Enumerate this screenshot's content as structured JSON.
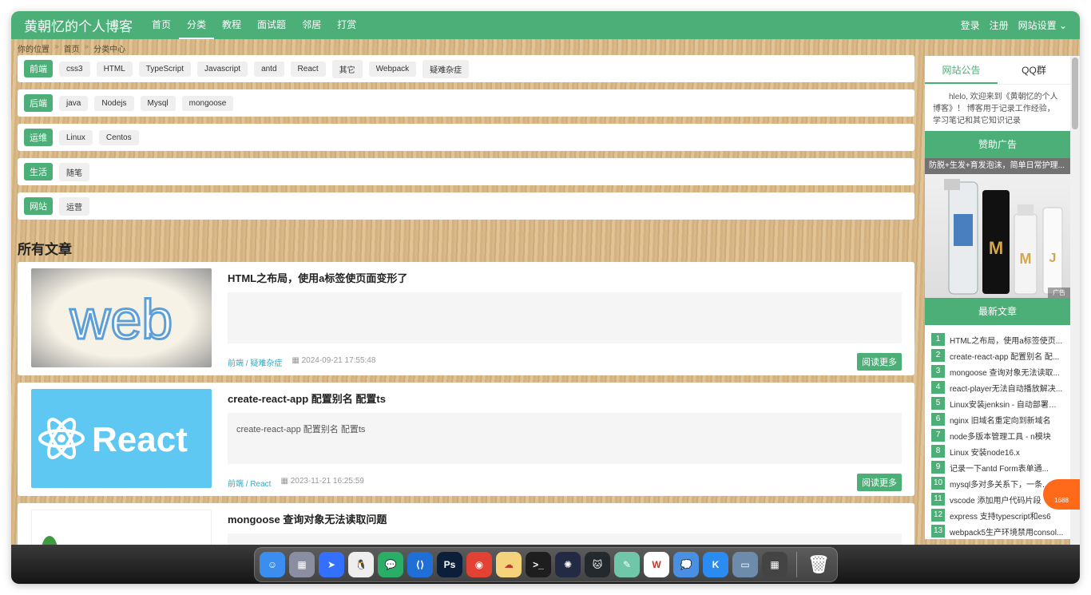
{
  "header": {
    "brand": "黄朝忆的个人博客",
    "nav": [
      "首页",
      "分类",
      "教程",
      "面试题",
      "邻居",
      "打赏"
    ],
    "active_nav": "分类",
    "login": "登录",
    "register": "注册",
    "settings": "网站设置 ⌄"
  },
  "breadcrumb": [
    "你的位置",
    "首页",
    "分类中心"
  ],
  "breadcrumb_sep": "»",
  "categories": [
    {
      "name": "前端",
      "tags": [
        "css3",
        "HTML",
        "TypeScript",
        "Javascript",
        "antd",
        "React",
        "其它",
        "Webpack",
        "疑难杂症"
      ]
    },
    {
      "name": "后端",
      "tags": [
        "java",
        "Nodejs",
        "Mysql",
        "mongoose"
      ]
    },
    {
      "name": "运维",
      "tags": [
        "Linux",
        "Centos"
      ]
    },
    {
      "name": "生活",
      "tags": [
        "随笔"
      ]
    },
    {
      "name": "网站",
      "tags": [
        "运营"
      ]
    }
  ],
  "section_title": "所有文章",
  "articles": [
    {
      "title": "HTML之布局，使用a标签使页面变形了",
      "excerpt": "",
      "cat": "前端 / 疑难杂症",
      "date": "2024-09-21 17:55:48",
      "read_more": "阅读更多",
      "thumb_text": "web"
    },
    {
      "title": "create-react-app 配置别名 配置ts",
      "excerpt": "create-react-app 配置别名 配置ts",
      "cat": "前端 / React",
      "date": "2023-11-21 16:25:59",
      "read_more": "阅读更多",
      "thumb_text": "React"
    },
    {
      "title": "mongoose 查询对象无法读取问题",
      "excerpt": "",
      "cat": "",
      "date": "",
      "read_more": "",
      "thumb_text": ""
    }
  ],
  "sidebar": {
    "tabs": [
      "网站公告",
      "QQ群"
    ],
    "notice": "hlelo, 欢迎来到《黄朝忆的个人博客》！ 博客用于记录工作经验，学习笔记和其它知识记录",
    "sponsor_title": "赞助广告",
    "ad_caption": "防脱+生发+育发泡沫，简单日常护理...",
    "ad_tag": "广告",
    "latest_title": "最新文章",
    "latest": [
      {
        "n": "1",
        "t": "HTML之布局，使用a标签使页..."
      },
      {
        "n": "2",
        "t": "create-react-app 配置别名 配..."
      },
      {
        "n": "3",
        "t": "mongoose 查询对象无法读取..."
      },
      {
        "n": "4",
        "t": "react-player无法自动播放解决..."
      },
      {
        "n": "5",
        "t": "Linux安装jenksin - 自动部署工具"
      },
      {
        "n": "6",
        "t": "nginx 旧域名重定向到新域名"
      },
      {
        "n": "7",
        "t": "node多版本管理工具 - n模块"
      },
      {
        "n": "8",
        "t": "Linux 安装node16.x"
      },
      {
        "n": "9",
        "t": "记录一下antd Form表单通..."
      },
      {
        "n": "10",
        "t": "mysql多对多关系下，一条..."
      },
      {
        "n": "11",
        "t": "vscode 添加用户代码片段"
      },
      {
        "n": "12",
        "t": "express 支持typescript和es6"
      },
      {
        "n": "13",
        "t": "webpack5生产环境禁用consol..."
      }
    ]
  },
  "float_badge": "1688",
  "colors": {
    "accent": "#4caf78",
    "link": "#3aa8c1"
  },
  "dock": [
    {
      "name": "finder",
      "color": "#3b8ef0",
      "label": "☺"
    },
    {
      "name": "launchpad",
      "color": "#8a8ea0",
      "label": "▦"
    },
    {
      "name": "feishu",
      "color": "#3370ff",
      "label": "➤"
    },
    {
      "name": "qq",
      "color": "#eeeeee",
      "label": "🐧"
    },
    {
      "name": "wechat",
      "color": "#2aae67",
      "label": "💬"
    },
    {
      "name": "vscode",
      "color": "#1f6fd6",
      "label": "⟨⟩"
    },
    {
      "name": "photoshop",
      "color": "#0b1e3a",
      "label": "Ps"
    },
    {
      "name": "chrome",
      "color": "#e34133",
      "label": "◉"
    },
    {
      "name": "baidunetdisk",
      "color": "#f4d37a",
      "label": "☁"
    },
    {
      "name": "terminal",
      "color": "#1e1e1e",
      "label": ">_"
    },
    {
      "name": "chatgpt",
      "color": "#222a44",
      "label": "✺"
    },
    {
      "name": "github",
      "color": "#24292e",
      "label": "🐱"
    },
    {
      "name": "qimoo",
      "color": "#6fc6a8",
      "label": "✎"
    },
    {
      "name": "wps",
      "color": "#ffffff",
      "label": "W"
    },
    {
      "name": "messenger",
      "color": "#4a90e2",
      "label": "💭"
    },
    {
      "name": "kugou",
      "color": "#2a8cf0",
      "label": "K"
    },
    {
      "name": "preview",
      "color": "#6d8cab",
      "label": "▭"
    },
    {
      "name": "calculator",
      "color": "#444444",
      "label": "▦"
    }
  ],
  "trash": "🗑"
}
